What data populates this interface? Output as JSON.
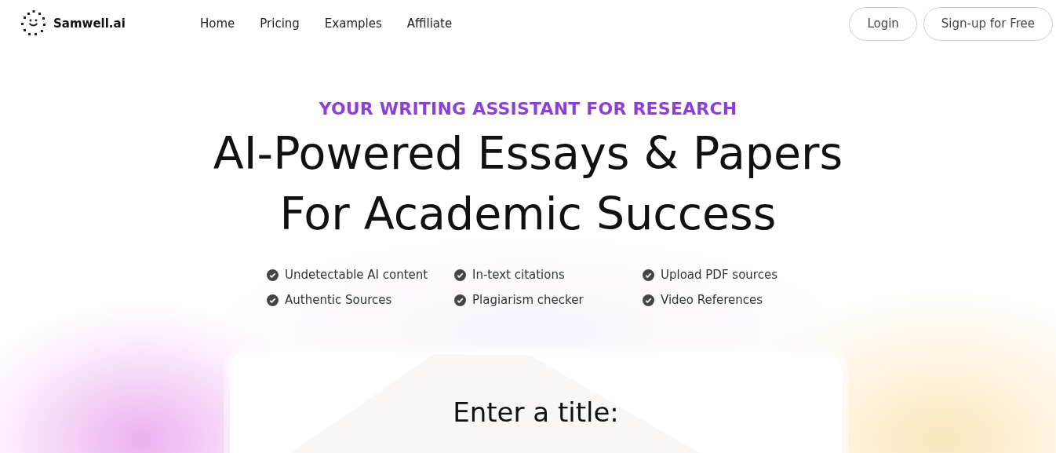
{
  "header": {
    "brand": "Samwell.ai",
    "nav": [
      {
        "label": "Home"
      },
      {
        "label": "Pricing"
      },
      {
        "label": "Examples"
      },
      {
        "label": "Affiliate"
      }
    ],
    "buttons": [
      {
        "label": "Login"
      },
      {
        "label": "Sign-up for Free"
      }
    ]
  },
  "hero": {
    "eyebrow": "YOUR WRITING ASSISTANT FOR RESEARCH",
    "title_lines": [
      "AI-Powered Essays & Papers",
      "For Academic Success"
    ],
    "features": [
      {
        "label": "Undetectable AI content"
      },
      {
        "label": "In-text citations"
      },
      {
        "label": "Upload PDF sources"
      },
      {
        "label": "Authentic Sources"
      },
      {
        "label": "Plagiarism checker"
      },
      {
        "label": "Video References"
      }
    ]
  },
  "card": {
    "heading": "Enter a title:"
  }
}
